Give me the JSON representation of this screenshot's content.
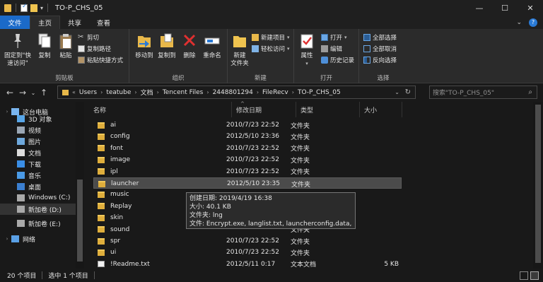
{
  "window": {
    "title": "TO-P_CHS_05",
    "minimize": "—",
    "maximize": "☐",
    "close": "✕"
  },
  "ribbon_tabs": [
    "文件",
    "主页",
    "共享",
    "查看"
  ],
  "ribbon": {
    "clipboard": {
      "label": "剪贴板",
      "pin": "固定到\"快速访问\"",
      "copy": "复制",
      "paste": "粘贴",
      "cut": "剪切",
      "copy_path": "复制路径",
      "paste_shortcut": "粘贴快捷方式"
    },
    "organize": {
      "label": "组织",
      "move_to": "移动到",
      "copy_to": "复制到",
      "delete": "删除",
      "rename": "重命名"
    },
    "new": {
      "label": "新建",
      "new_folder": "新建\n文件夹",
      "new_item": "新建项目",
      "easy_access": "轻松访问"
    },
    "open": {
      "label": "打开",
      "properties": "属性",
      "open": "打开",
      "edit": "编辑",
      "history": "历史记录"
    },
    "select": {
      "label": "选择",
      "select_all": "全部选择",
      "select_none": "全部取消",
      "invert": "反向选择"
    }
  },
  "address": {
    "crumbs": [
      "Users",
      "teatube",
      "文档",
      "Tencent Files",
      "2448801294",
      "FileRecv",
      "TO-P_CHS_05"
    ],
    "search_placeholder": "搜索\"TO-P_CHS_05\""
  },
  "nav_pane": [
    {
      "label": "这台电脑",
      "icon": "computer-icon",
      "top": true
    },
    {
      "label": "3D 对象",
      "icon": "cube-icon"
    },
    {
      "label": "视频",
      "icon": "video-icon"
    },
    {
      "label": "图片",
      "icon": "picture-icon"
    },
    {
      "label": "文档",
      "icon": "document-icon"
    },
    {
      "label": "下载",
      "icon": "download-icon"
    },
    {
      "label": "音乐",
      "icon": "music-icon"
    },
    {
      "label": "桌面",
      "icon": "desktop-icon"
    },
    {
      "label": "Windows (C:)",
      "icon": "drive-icon"
    },
    {
      "label": "新加卷 (D:)",
      "icon": "drive-icon",
      "selected": true
    },
    {
      "label": "新加卷 (E:)",
      "icon": "drive-icon"
    },
    {
      "label": "网络",
      "icon": "network-icon",
      "top": true
    }
  ],
  "columns": [
    "名称",
    "修改日期",
    "类型",
    "大小"
  ],
  "files": [
    {
      "name": "ai",
      "date": "2010/7/23 22:52",
      "type": "文件夹",
      "size": "",
      "kind": "folder"
    },
    {
      "name": "config",
      "date": "2012/5/10 23:36",
      "type": "文件夹",
      "size": "",
      "kind": "folder"
    },
    {
      "name": "font",
      "date": "2010/7/23 22:52",
      "type": "文件夹",
      "size": "",
      "kind": "folder"
    },
    {
      "name": "image",
      "date": "2010/7/23 22:52",
      "type": "文件夹",
      "size": "",
      "kind": "folder"
    },
    {
      "name": "ipl",
      "date": "2010/7/23 22:52",
      "type": "文件夹",
      "size": "",
      "kind": "folder"
    },
    {
      "name": "launcher",
      "date": "2012/5/10 23:35",
      "type": "文件夹",
      "size": "",
      "kind": "folder",
      "selected": true
    },
    {
      "name": "music",
      "date": "",
      "type": "",
      "size": "",
      "kind": "folder"
    },
    {
      "name": "Replay",
      "date": "",
      "type": "",
      "size": "",
      "kind": "folder"
    },
    {
      "name": "skin",
      "date": "",
      "type": "",
      "size": "",
      "kind": "folder"
    },
    {
      "name": "sound",
      "date": "",
      "type": "文件夹",
      "size": "",
      "kind": "folder"
    },
    {
      "name": "spr",
      "date": "2010/7/23 22:52",
      "type": "文件夹",
      "size": "",
      "kind": "folder"
    },
    {
      "name": "ui",
      "date": "2010/7/23 22:52",
      "type": "文件夹",
      "size": "",
      "kind": "folder"
    },
    {
      "name": "!Readme.txt",
      "date": "2012/5/11 0:17",
      "type": "文本文档",
      "size": "5 KB",
      "kind": "txt"
    }
  ],
  "tooltip": [
    "创建日期: 2019/4/19 16:38",
    "大小: 40.1 KB",
    "文件夹: lng",
    "文件: Encrypt.exe, langlist.txt, launcherconfig.data, ..."
  ],
  "status": {
    "count": "20 个项目",
    "selected": "选中 1 个项目"
  }
}
